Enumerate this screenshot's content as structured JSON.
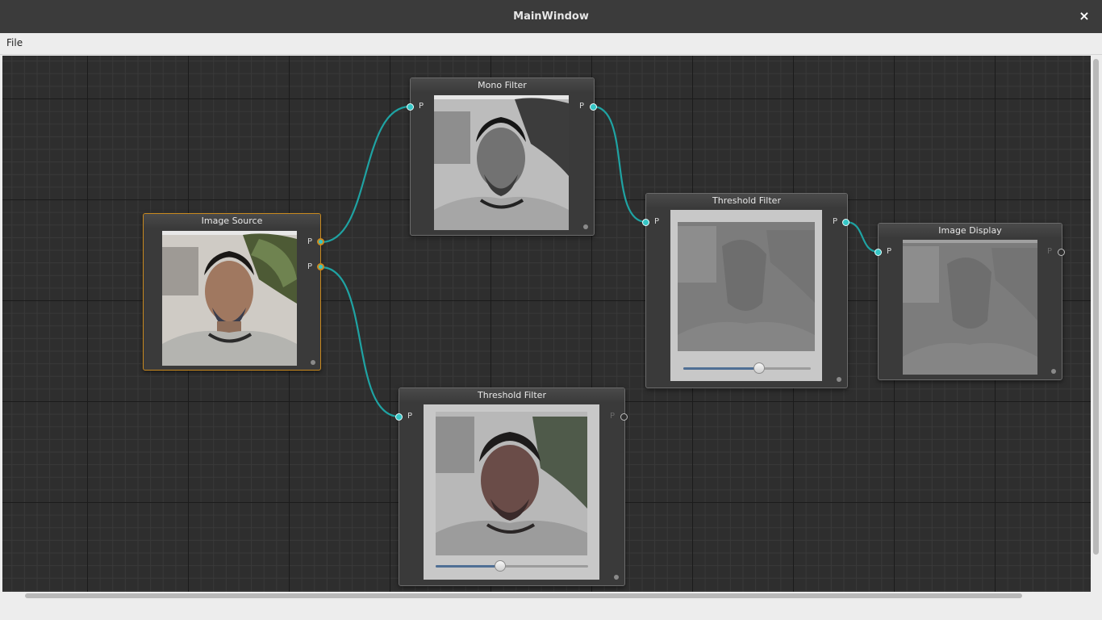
{
  "window": {
    "title": "MainWindow",
    "close_glyph": "×"
  },
  "menu": {
    "file": "File"
  },
  "nodes": {
    "image_source": {
      "title": "Image Source",
      "out1": "P",
      "out2": "P",
      "image": "color-portrait-photo"
    },
    "mono_filter": {
      "title": "Mono Filter",
      "in": "P",
      "out": "P",
      "image": "grayscale-portrait-photo"
    },
    "threshold_top": {
      "title": "Threshold Filter",
      "in": "P",
      "out": "P",
      "slider_value": 0.6,
      "image": "threshold-portrait-photo"
    },
    "image_display": {
      "title": "Image Display",
      "in": "P",
      "out": "P",
      "image": "threshold-portrait-photo"
    },
    "threshold_bottom": {
      "title": "Threshold Filter",
      "in": "P",
      "out": "P",
      "slider_value": 0.42,
      "image": "tinted-portrait-photo"
    }
  },
  "colors": {
    "wire": "#1fa3a3",
    "port": "#35c6c6",
    "selected": "#c98a1f",
    "slider_fill": "#4f6f95"
  }
}
